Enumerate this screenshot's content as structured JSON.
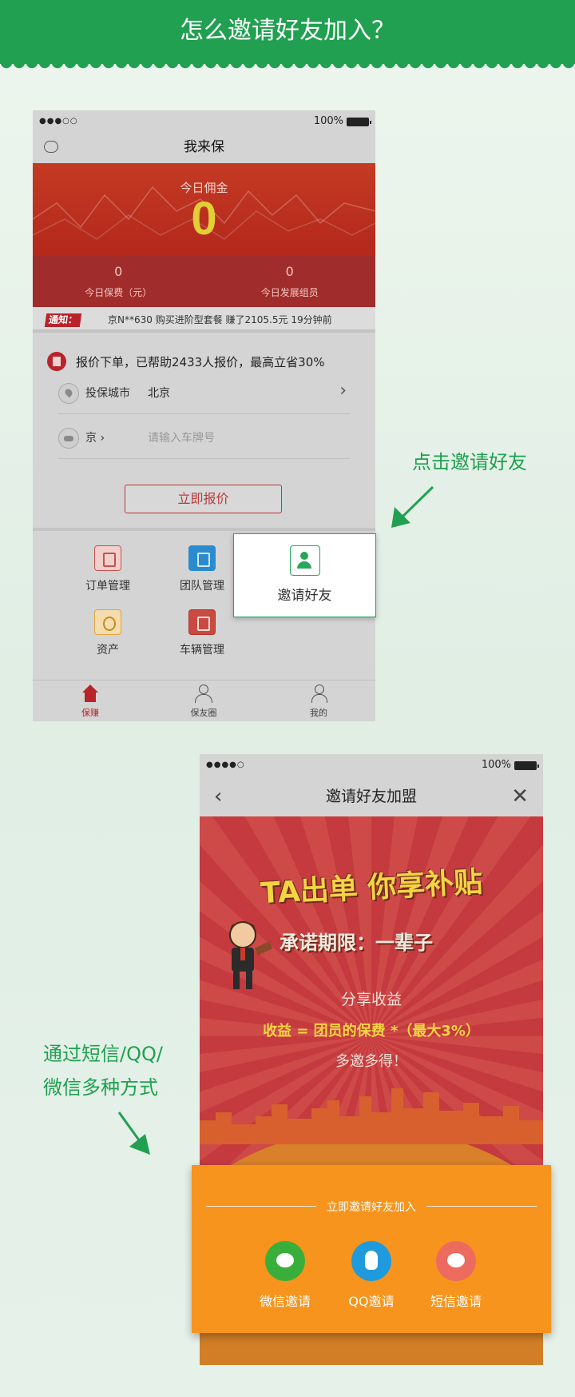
{
  "header": {
    "title": "怎么邀请好友加入？"
  },
  "phone1": {
    "status": {
      "battery": "100%"
    },
    "nav_title": "我来保",
    "hero": {
      "title": "今日佣金",
      "amount": "0",
      "stats": [
        {
          "value": "0",
          "label": "今日保费（元）"
        },
        {
          "value": "0",
          "label": "今日发展组员"
        }
      ]
    },
    "notice": {
      "badge": "通知：",
      "text": "京N**630 购买进阶型套餐 赚了2105.5元 19分钟前"
    },
    "quote": {
      "headline": "报价下单，已帮助2433人报价，最高立省30%",
      "city_label": "投保城市",
      "city_value": "北京",
      "plate_prefix": "京 ›",
      "plate_placeholder": "请输入车牌号",
      "button": "立即报价"
    },
    "grid": [
      {
        "label": "订单管理"
      },
      {
        "label": "团队管理"
      },
      {
        "label": "邀请好友"
      },
      {
        "label": "资产"
      },
      {
        "label": "车辆管理"
      }
    ],
    "tabs": [
      {
        "label": "保赚"
      },
      {
        "label": "保友圈"
      },
      {
        "label": "我的"
      }
    ]
  },
  "callouts": {
    "tap_invite": "点击邀请好友",
    "methods_line1": "通过短信/QQ/",
    "methods_line2": "微信多种方式"
  },
  "phone2": {
    "status": {
      "battery": "100%"
    },
    "nav_title": "邀请好友加盟",
    "poster": {
      "title": "TA出单 你享补贴",
      "promise": "承诺期限：一辈子",
      "share": "分享收益",
      "formula": "收益 = 团员的保费 *（最大3%）",
      "more": "多邀多得！"
    }
  },
  "share_panel": {
    "heading": "立即邀请好友加入",
    "options": [
      {
        "label": "微信邀请",
        "icon": "wechat-icon",
        "color": "#3aae3a"
      },
      {
        "label": "QQ邀请",
        "icon": "qq-icon",
        "color": "#1f9adc"
      },
      {
        "label": "短信邀请",
        "icon": "sms-icon",
        "color": "#ec6b5e"
      }
    ]
  }
}
